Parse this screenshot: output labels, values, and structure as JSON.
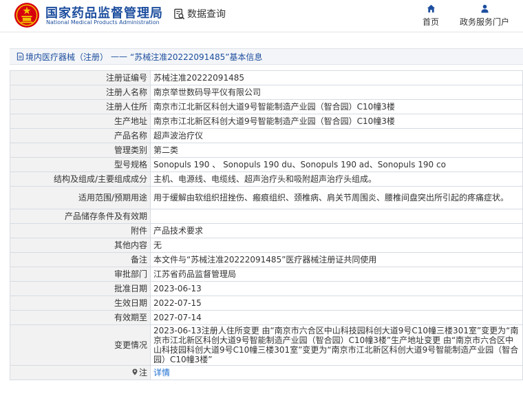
{
  "header": {
    "site_name_cn": "国家药品监督管理局",
    "site_name_en": "National Medical Products Administration",
    "query_label": "数据查询",
    "nav": [
      {
        "label": "首页",
        "icon": "home-icon"
      },
      {
        "label": "政务服务门户",
        "icon": "user-icon"
      }
    ]
  },
  "breadcrumb": {
    "section": "境内医疗器械（注册）",
    "sep": "——",
    "title": "“苏械注准20222091485”基本信息"
  },
  "record": {
    "rows": [
      {
        "key": "注册证编号",
        "value": "苏械注准20222091485"
      },
      {
        "key": "注册人名称",
        "value": "南京举世数码导平仪有限公司"
      },
      {
        "key": "注册人住所",
        "value": "南京市江北新区科创大道9号智能制造产业园（智合园）C10幢3楼"
      },
      {
        "key": "生产地址",
        "value": "南京市江北新区科创大道9号智能制造产业园（智合园）C10幢3楼"
      },
      {
        "key": "产品名称",
        "value": "超声波治疗仪"
      },
      {
        "key": "管理类别",
        "value": "第二类"
      },
      {
        "key": "型号规格",
        "value": "Sonopuls 190 、 Sonopuls 190 du、Sonopuls 190 ad、Sonopuls 190 co"
      },
      {
        "key": "结构及组成/主要组成成分",
        "value": "主机、电源线、电缆线、超声治疗头和吸附超声治疗头组成。"
      },
      {
        "key": "适用范围/预期用途",
        "value": "用于缓解由软组织扭挫伤、瘢痕组织、颈椎病、肩关节周围炎、腰椎间盘突出所引起的疼痛症状。"
      },
      {
        "key": "产品储存条件及有效期",
        "value": ""
      },
      {
        "key": "附件",
        "value": "产品技术要求"
      },
      {
        "key": "其他内容",
        "value": "无"
      },
      {
        "key": "备注",
        "value": "本文件与“苏械注准20222091485”医疗器械注册证共同使用"
      },
      {
        "key": "审批部门",
        "value": "江苏省药品监督管理局"
      },
      {
        "key": "批准日期",
        "value": "2023-06-13"
      },
      {
        "key": "生效日期",
        "value": "2022-07-15"
      },
      {
        "key": "有效期至",
        "value": "2027-07-14"
      },
      {
        "key": "变更情况",
        "value": "2023-06-13注册人住所变更 由“南京市六合区中山科技园科创大道9号C10幢三楼301室”变更为“南京市江北新区科创大道9号智能制造产业园（智合园）C10幢3楼”生产地址变更 由“南京市六合区中山科技园科创大道9号C10幢三楼301室”变更为“南京市江北新区科创大道9号智能制造产业园（智合园）C10幢3楼”"
      },
      {
        "key": "注",
        "value": "详情"
      }
    ]
  },
  "colors": {
    "brand_blue": "#1d4e9e",
    "link_blue": "#1d6fd1",
    "logo_red": "#d7000f",
    "logo_gold": "#f2c300"
  }
}
